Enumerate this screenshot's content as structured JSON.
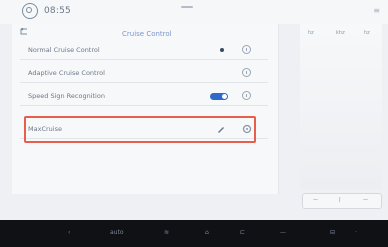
{
  "status": {
    "time": "08:55"
  },
  "panel": {
    "title": "Cruise Control",
    "rows": [
      {
        "label": "Normal Cruise Control"
      },
      {
        "label": "Adaptive Cruise Control"
      },
      {
        "label": "Speed Sign Recognition"
      },
      {
        "label": "MaxCruise"
      }
    ]
  },
  "right": {
    "headers": [
      "hz",
      "khz",
      "hz"
    ],
    "buttons": [
      "—",
      "|",
      "—"
    ]
  },
  "taskbar": {
    "items": [
      "‹",
      "auto",
      "≋",
      "⌂",
      "⊏",
      "—",
      "⊟",
      "·"
    ]
  },
  "colors": {
    "accent": "#2f6ac8",
    "highlight": "#e85e4c"
  }
}
